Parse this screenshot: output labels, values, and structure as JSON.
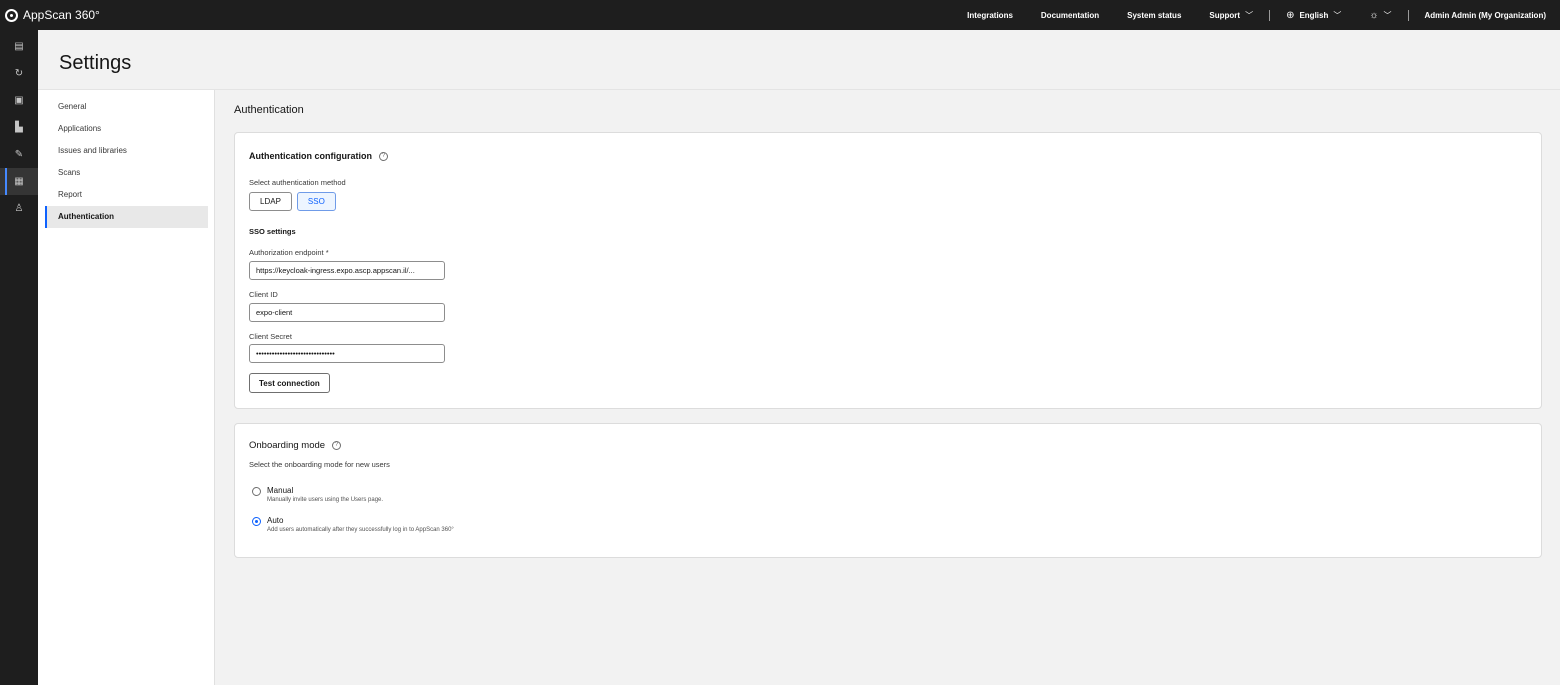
{
  "app": {
    "title": "AppScan 360°"
  },
  "topnav": {
    "integrations": "Integrations",
    "documentation": "Documentation",
    "system_status": "System status",
    "support": "Support",
    "language": "English",
    "user": "Admin Admin (My Organization)"
  },
  "rail": {
    "items": [
      {
        "icon": "dashboard-icon"
      },
      {
        "icon": "refresh-icon"
      },
      {
        "icon": "portfolio-icon"
      },
      {
        "icon": "building-icon"
      },
      {
        "icon": "tools-icon"
      },
      {
        "icon": "settings-icon",
        "active": true
      },
      {
        "icon": "user-icon"
      }
    ]
  },
  "page": {
    "title": "Settings"
  },
  "subnav": {
    "items": [
      {
        "label": "General"
      },
      {
        "label": "Applications"
      },
      {
        "label": "Issues and libraries"
      },
      {
        "label": "Scans"
      },
      {
        "label": "Report"
      },
      {
        "label": "Authentication",
        "active": true
      }
    ]
  },
  "auth": {
    "section_title": "Authentication",
    "card_title": "Authentication configuration",
    "method_label": "Select authentication method",
    "methods": [
      "LDAP",
      "SSO"
    ],
    "selected_method": "SSO",
    "sso_heading": "SSO settings",
    "endpoint_label": "Authorization endpoint *",
    "endpoint_value": "https://keycloak-ingress.expo.ascp.appscan.il/...",
    "client_id_label": "Client ID",
    "client_id_value": "expo-client",
    "client_secret_label": "Client Secret",
    "client_secret_value": "••••••••••••••••••••••••••••••",
    "test_button": "Test connection"
  },
  "onboarding": {
    "card_title": "Onboarding mode",
    "description": "Select the onboarding mode for new users",
    "options": [
      {
        "label": "Manual",
        "desc": "Manually invite users using the Users page.",
        "checked": false
      },
      {
        "label": "Auto",
        "desc": "Add users automatically after they successfully log in to AppScan 360°",
        "checked": true
      }
    ]
  },
  "colors": {
    "accent": "#0f62fe",
    "topbar": "#1e1e1e",
    "background": "#f2f2f2"
  }
}
